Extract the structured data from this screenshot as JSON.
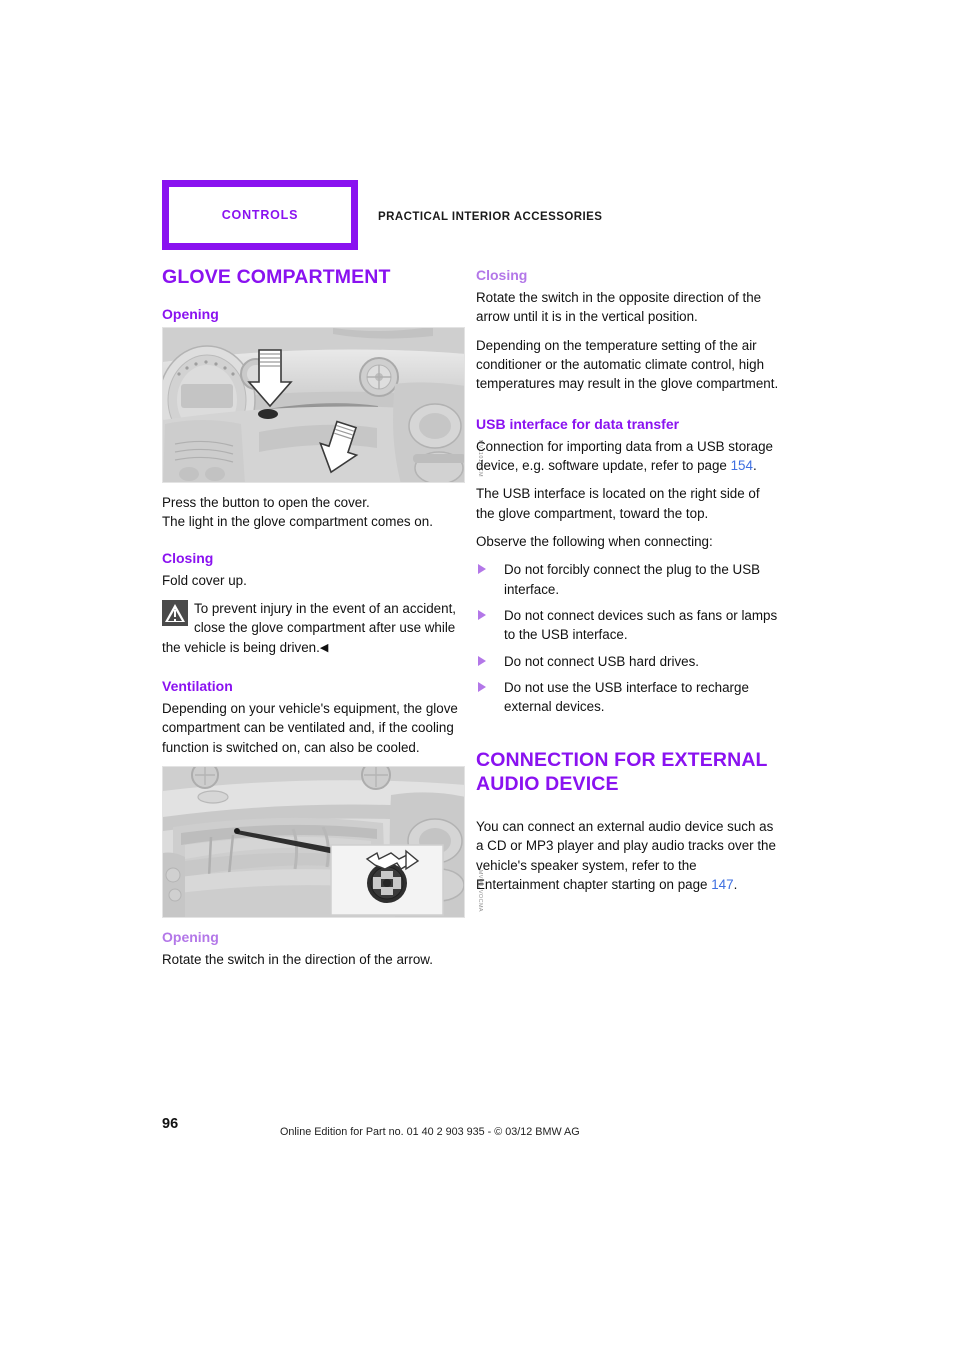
{
  "header": {
    "chapter": "CONTROLS",
    "section": "PRACTICAL INTERIOR ACCESSORIES"
  },
  "colors": {
    "accent": "#8A12F0",
    "accent_light": "#B377E8",
    "page_ref": "#3E6FE0",
    "warning_icon_bg": "#4A4A4A"
  },
  "left_column": {
    "title": "GLOVE COMPARTMENT",
    "opening_heading": "Opening",
    "figure1_code": "MV1101 1CM",
    "opening_text_line1": "Press the button to open the cover.",
    "opening_text_line2": "The light in the glove compartment comes on.",
    "closing_heading": "Closing",
    "closing_text": "Fold cover up.",
    "warning_text": "To prevent injury in the event of an accident, close the glove compartment after use while the vehicle is being driven.",
    "warning_endmark": "◀",
    "ventilation_heading": "Ventilation",
    "ventilation_text": "Depending on your vehicle's equipment, the glove compartment can be ventilated and, if the cooling function is switched on, can also be cooled.",
    "figure2_code": "MV0UJVOCMA",
    "opening2_heading": "Opening",
    "opening2_text": "Rotate the switch in the direction of the arrow."
  },
  "right_column": {
    "closing_heading": "Closing",
    "closing_text_1": "Rotate the switch in the opposite direction of the arrow until it is in the vertical position.",
    "closing_text_2": "Depending on the temperature setting of the air conditioner or the automatic climate control, high temperatures may result in the glove compartment.",
    "usb_heading": "USB interface for data transfer",
    "usb_text_1_before": "Connection for importing data from a USB storage device, e.g. software update, refer to page ",
    "usb_text_1_ref": "154",
    "usb_text_1_after": ".",
    "usb_text_2": "The USB interface is located on the right side of the glove compartment, toward the top.",
    "usb_text_3": "Observe the following when connecting:",
    "usb_bullets": [
      "Do not forcibly connect the plug to the USB interface.",
      "Do not connect devices such as fans or lamps to the USB interface.",
      "Do not connect USB hard drives.",
      "Do not use the USB interface to recharge external devices."
    ],
    "audio_title": "CONNECTION FOR EXTERNAL AUDIO DEVICE",
    "audio_text_before": "You can connect an external audio device such as a CD or MP3 player and play audio tracks over the vehicle's speaker system, refer to the Entertainment chapter starting on page ",
    "audio_text_ref": "147",
    "audio_text_after": "."
  },
  "footer": {
    "page_number": "96",
    "imprint": "Online Edition for Part no. 01 40 2 903 935 - © 03/12 BMW AG"
  }
}
